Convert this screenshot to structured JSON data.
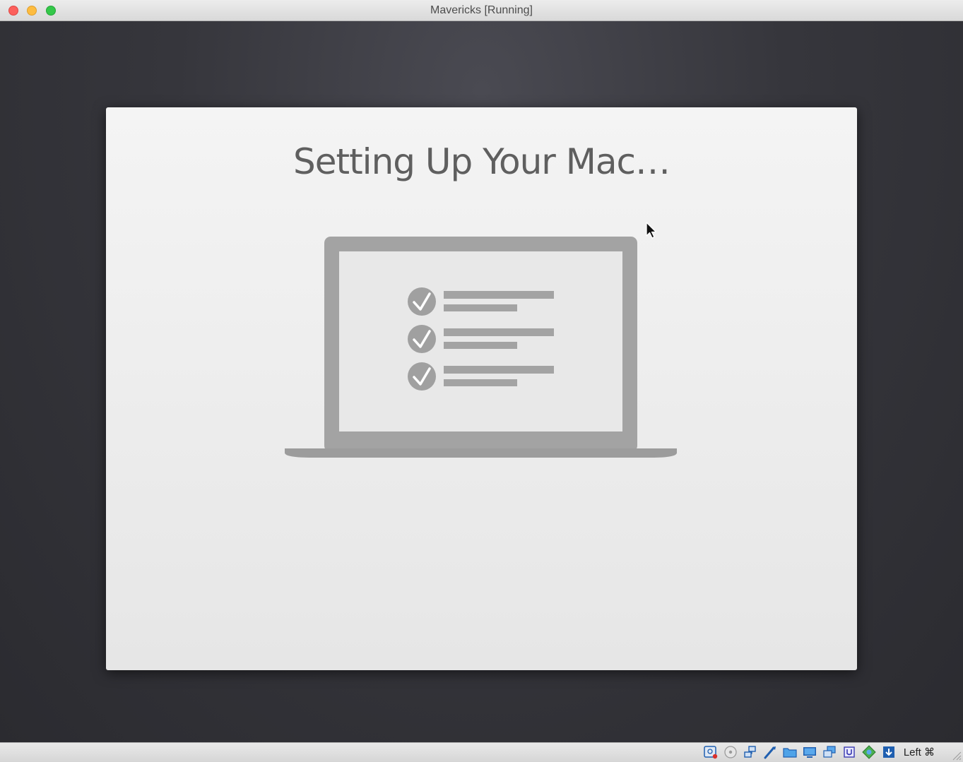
{
  "window": {
    "title": "Mavericks [Running]"
  },
  "setup": {
    "heading": "Setting Up Your Mac…",
    "illustration": {
      "icon": "laptop-checklist-icon",
      "checklist_items": 3
    }
  },
  "statusbar": {
    "icons": [
      "hard-disk-icon",
      "optical-drive-icon",
      "network-icon",
      "usb-icon",
      "shared-folders-icon",
      "display-icon",
      "video-capture-icon",
      "cpu-vt-icon",
      "mouse-integration-icon",
      "keyboard-capture-icon"
    ],
    "host_key": "Left ⌘"
  },
  "colors": {
    "desktop_bg": "#2e2e33",
    "panel_bg": "#f0f0f0",
    "heading": "#5f5f5f",
    "laptop_gray": "#9e9e9e"
  }
}
